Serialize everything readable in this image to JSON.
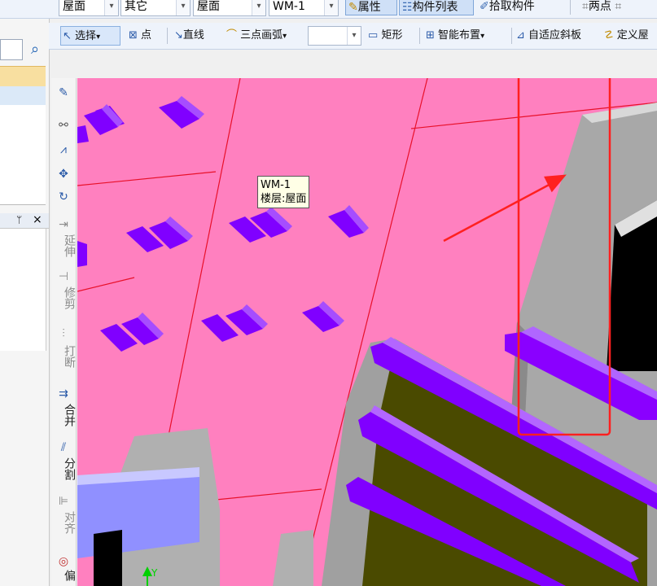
{
  "toolbar_row1": {
    "floor_select": "屋面",
    "type_select": "其它",
    "floor_select2": "屋面",
    "component_select": "WM-1",
    "properties_label": "属性",
    "component_list_label": "构件列表",
    "pick_component_label": "拾取构件",
    "two_point_label": "两点"
  },
  "toolbar_row2": {
    "select_label": "选择",
    "point_label": "点",
    "line_label": "直线",
    "arc_label": "三点画弧",
    "rect_label": "矩形",
    "smart_layout_label": "智能布置",
    "adaptive_slab_label": "自适应斜板",
    "define_label": "定义屋"
  },
  "left_panel": {
    "pin_glyph": "ᛘ",
    "close_glyph": "×",
    "search_glyph": "⌕"
  },
  "vertical_toolbar": {
    "extend_label": "延伸",
    "trim_label": "修剪",
    "break_label": "打断",
    "merge_label": "合并",
    "split_label": "分割",
    "align_label": "对齐",
    "offset_label": "偏"
  },
  "tooltip": {
    "line1": "WM-1",
    "line2": "楼层:屋面"
  },
  "axis": {
    "y_label": "Y"
  },
  "colors": {
    "roof_pink": "#ff80bf",
    "beam_purple": "#8000ff",
    "wall_gray": "#a0a0a0",
    "olive_wall": "#4a4a00",
    "highlight_red": "#ff2020"
  }
}
